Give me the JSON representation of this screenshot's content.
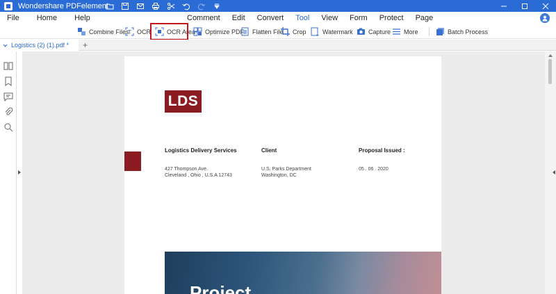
{
  "app": {
    "title": "Wondershare PDFelement"
  },
  "menu": {
    "left": [
      "File",
      "Home",
      "Help"
    ],
    "center": [
      "Comment",
      "Edit",
      "Convert",
      "Tool",
      "View",
      "Form",
      "Protect",
      "Page"
    ],
    "active": "Tool"
  },
  "toolbar": {
    "combine_files": "Combine Files",
    "ocr": "OCR",
    "ocr_area": "OCR Area",
    "optimize_pdf": "Optimize PDF",
    "flatten_file": "Flatten File",
    "crop": "Crop",
    "watermark": "Watermark",
    "capture": "Capture",
    "more": "More",
    "batch_process": "Batch Process"
  },
  "tabs": {
    "doc_tab": "Logistics (2) (1).pdf *",
    "new_tab": "+"
  },
  "document": {
    "logo": "LDS",
    "col1": {
      "heading": "Logistics Delivery Services",
      "line1": "427 Thompson Ave.",
      "line2": "Cleveland , Ohio , U.S.A 12743"
    },
    "col2": {
      "heading": "Client",
      "line1": "U.S. Parks Department",
      "line2": "Washington, DC"
    },
    "col3": {
      "heading": "Proposal Issued :",
      "line1": "05 . 06 . 2020"
    },
    "hero_title": "Project"
  },
  "colors": {
    "brand_blue": "#2a6bd5",
    "logo_red": "#8b1d22",
    "highlight": "#c4161c"
  }
}
